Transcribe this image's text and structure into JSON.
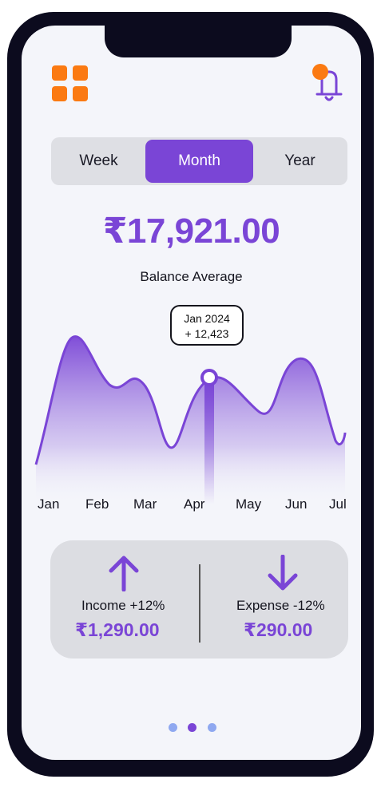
{
  "header": {
    "menu_icon": "grid-icon",
    "notification_icon": "bell-icon",
    "accent": "#fb7a12"
  },
  "period_tabs": [
    {
      "label": "Week",
      "active": false
    },
    {
      "label": "Month",
      "active": true
    },
    {
      "label": "Year",
      "active": false
    }
  ],
  "balance": {
    "amount": "₹17,921.00",
    "label": "Balance Average"
  },
  "chart": {
    "months": [
      "Jan",
      "Feb",
      "Mar",
      "Apr",
      "May",
      "Jun",
      "Jul"
    ],
    "tooltip": {
      "title": "Jan 2024",
      "value": "+ 12,423"
    }
  },
  "summary": {
    "income": {
      "icon": "arrow-up-icon",
      "label": "Income  +12%",
      "value": "₹1,290.00"
    },
    "expense": {
      "icon": "arrow-down-icon",
      "label": "Expense  -12%",
      "value": "₹290.00"
    }
  },
  "pager": {
    "count": 3,
    "active_index": 1
  },
  "colors": {
    "primary": "#7a45d6",
    "light_dot": "#8fa8f0",
    "screen_bg": "#f4f5fa"
  }
}
